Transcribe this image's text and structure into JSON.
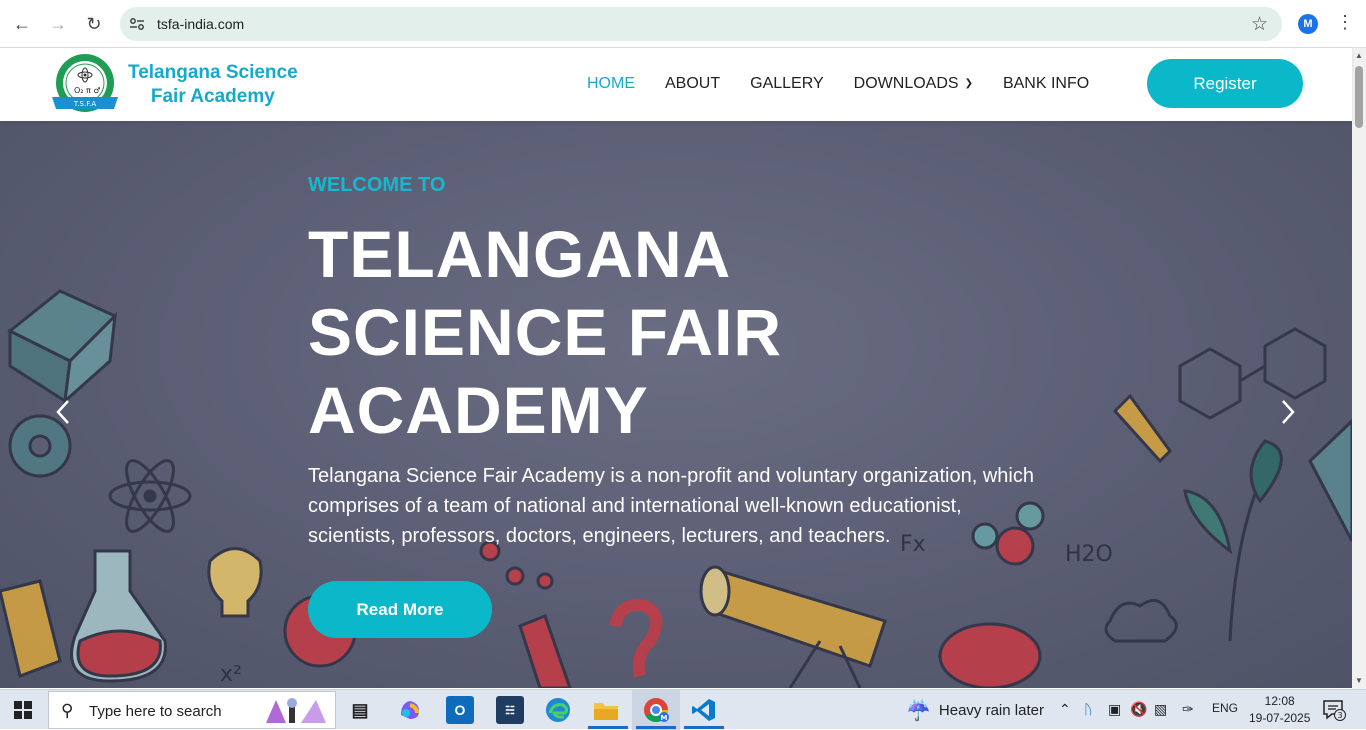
{
  "browser": {
    "url": "tsfa-india.com",
    "profile_initial": "M"
  },
  "header": {
    "brand_line1": "Telangana Science",
    "brand_line2": "Fair Academy",
    "logo_badge": "T.S.F.A",
    "menu": [
      {
        "label": "HOME",
        "active": true
      },
      {
        "label": "ABOUT",
        "active": false
      },
      {
        "label": "GALLERY",
        "active": false
      },
      {
        "label": "DOWNLOADS",
        "active": false
      },
      {
        "label": "BANK INFO",
        "active": false
      }
    ],
    "register_label": "Register"
  },
  "hero": {
    "welcome": "WELCOME TO",
    "headline_line1": "TELANGANA",
    "headline_line2": "SCIENCE FAIR",
    "headline_line3": "ACADEMY",
    "description": "Telangana Science Fair Academy is a non-profit and voluntary organization, which comprises of a team of national and international well-known educationist, scientists, professors, doctors, engineers, lecturers, and teachers.",
    "read_more_label": "Read More",
    "prev_icon": "chevron-left-icon",
    "next_icon": "chevron-right-icon"
  },
  "taskbar": {
    "search_placeholder": "Type here to search",
    "weather": "Heavy rain later",
    "language": "ENG",
    "time": "12:08",
    "date": "19-07-2025",
    "notifications": "3"
  },
  "colors": {
    "accent": "#0ab8c9",
    "brand_text": "#17a9c9"
  }
}
